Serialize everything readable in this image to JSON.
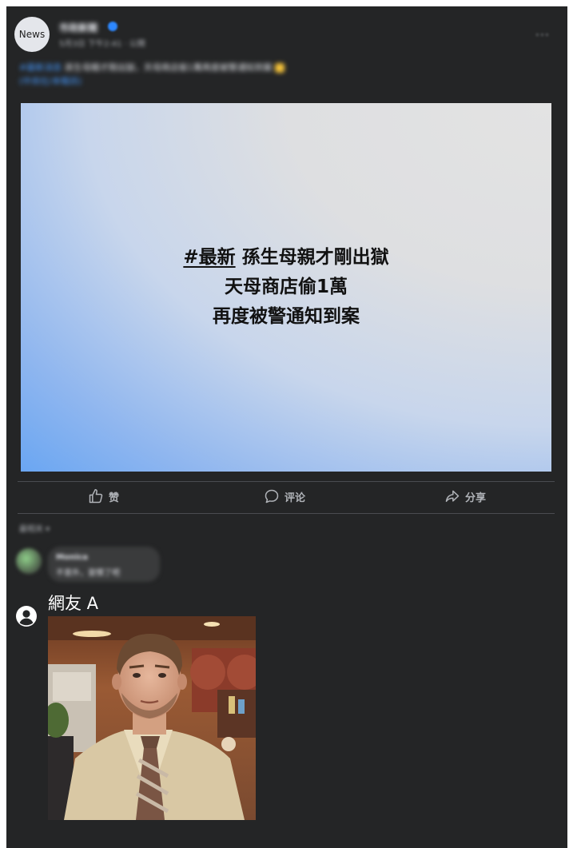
{
  "header": {
    "avatar_label": "News",
    "page_name": "市政新聞",
    "meta": "5月3日 下午2:41 · 公開",
    "more": "···"
  },
  "caption": {
    "tag": "#最新消息",
    "text": "孫生母親才剛出獄，天母商店偷1萬再度被警通知到案",
    "line2": "(中央社/本報訊)"
  },
  "image_headline": {
    "hashtag": "#最新",
    "line1_rest": " 孫生母親才剛出獄",
    "line2": "天母商店偷1萬",
    "line3": "再度被警通知到案"
  },
  "actions": {
    "like": "赞",
    "comment": "评论",
    "share": "分享"
  },
  "comments": {
    "sort_label": "最相关",
    "blurred": {
      "name": "Monica",
      "text": "不意外，習慣了吧"
    },
    "main": {
      "name": "網友 A"
    }
  },
  "colors": {
    "card_bg": "#242526",
    "accent_blue": "#2d88ff",
    "text_primary": "#e4e6eb",
    "text_secondary": "#b0b3b8"
  }
}
